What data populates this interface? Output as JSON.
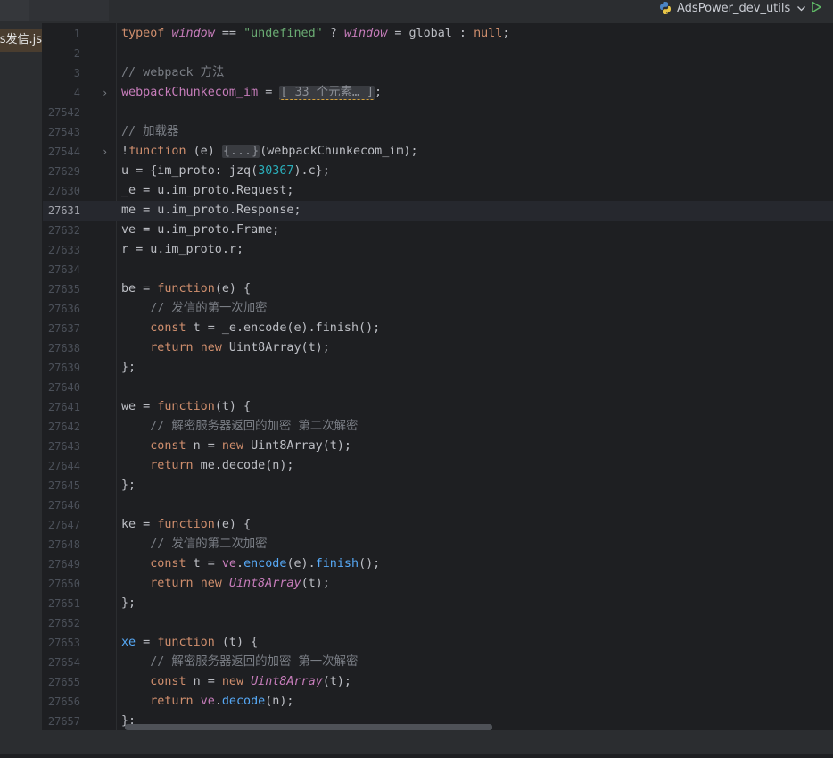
{
  "topbar": {
    "run_config_label": "AdsPower_dev_utils",
    "chevron": "chevron-down",
    "run_icon": "play-icon"
  },
  "file_tab": {
    "label": "ss发信.js"
  },
  "sidebar": {
    "more_glyph": "⋮"
  },
  "editor": {
    "lines": [
      {
        "n": "1"
      },
      {
        "n": "2"
      },
      {
        "n": "3"
      },
      {
        "n": "4"
      },
      {
        "n": "27542"
      },
      {
        "n": "27543"
      },
      {
        "n": "27544"
      },
      {
        "n": "27629"
      },
      {
        "n": "27630"
      },
      {
        "n": "27631"
      },
      {
        "n": "27632"
      },
      {
        "n": "27633"
      },
      {
        "n": "27634"
      },
      {
        "n": "27635"
      },
      {
        "n": "27636"
      },
      {
        "n": "27637"
      },
      {
        "n": "27638"
      },
      {
        "n": "27639"
      },
      {
        "n": "27640"
      },
      {
        "n": "27641"
      },
      {
        "n": "27642"
      },
      {
        "n": "27643"
      },
      {
        "n": "27644"
      },
      {
        "n": "27645"
      },
      {
        "n": "27646"
      },
      {
        "n": "27647"
      },
      {
        "n": "27648"
      },
      {
        "n": "27649"
      },
      {
        "n": "27650"
      },
      {
        "n": "27651"
      },
      {
        "n": "27652"
      },
      {
        "n": "27653"
      },
      {
        "n": "27654"
      },
      {
        "n": "27655"
      },
      {
        "n": "27656"
      },
      {
        "n": "27657"
      }
    ],
    "current_line": "27631",
    "code": {
      "l1": [
        "typeof",
        " ",
        "window",
        " == ",
        "\"undefined\"",
        " ? ",
        "window",
        " = global : ",
        "null",
        ";"
      ],
      "l3": "// webpack 方法",
      "l4": [
        "webpackChunkecom_im",
        " = ",
        "[ 33 个元素… ]",
        ";"
      ],
      "l27543": "// 加载器",
      "l27544": [
        "!",
        "function",
        " (e) ",
        "{...}",
        "(webpackChunkecom_im);"
      ],
      "l27629": [
        "u = {im_proto: jzq(",
        "30367",
        ").c};"
      ],
      "l27630": "_e = u.im_proto.Request;",
      "l27631": "me = u.im_proto.Response;",
      "l27632": "ve = u.im_proto.Frame;",
      "l27633": "r = u.im_proto.r;",
      "l27635": [
        "be = ",
        "function",
        "(e) {"
      ],
      "l27636": "    // 发信的第一次加密",
      "l27637": [
        "    ",
        "const",
        " t = _e.encode(e).finish();"
      ],
      "l27638": [
        "    ",
        "return",
        " ",
        "new",
        " Uint8Array(t);"
      ],
      "l27639": "};",
      "l27641": [
        "we = ",
        "function",
        "(t) {"
      ],
      "l27642": "    // 解密服务器返回的加密 第二次解密",
      "l27643": [
        "    ",
        "const",
        " n = ",
        "new",
        " Uint8Array(t);"
      ],
      "l27644": [
        "    ",
        "return",
        " me.decode(n);"
      ],
      "l27645": "};",
      "l27647": [
        "ke = ",
        "function",
        "(e) {"
      ],
      "l27648": "    // 发信的第二次加密",
      "l27649": [
        "    ",
        "const",
        " t = ",
        "ve",
        ".",
        "encode",
        "(e).",
        "finish",
        "();"
      ],
      "l27650": [
        "    ",
        "return",
        " ",
        "new",
        " ",
        "Uint8Array",
        "(t);"
      ],
      "l27651": "};",
      "l27653": [
        "xe",
        " = ",
        "function",
        " (t) {"
      ],
      "l27654": "    // 解密服务器返回的加密 第一次解密",
      "l27655": [
        "    ",
        "const",
        " n = ",
        "new",
        " ",
        "Uint8Array",
        "(t);"
      ],
      "l27656": [
        "    ",
        "return",
        " ",
        "ve",
        ".",
        "decode",
        "(n);"
      ],
      "l27657": "};"
    }
  },
  "colors": {
    "background": "#1e1f22",
    "keyword": "#cf8e6d",
    "string": "#6aab73",
    "number": "#2aacb8",
    "comment": "#7a7e85",
    "function_call": "#56a8f5",
    "global_italic": "#c77dbb"
  }
}
